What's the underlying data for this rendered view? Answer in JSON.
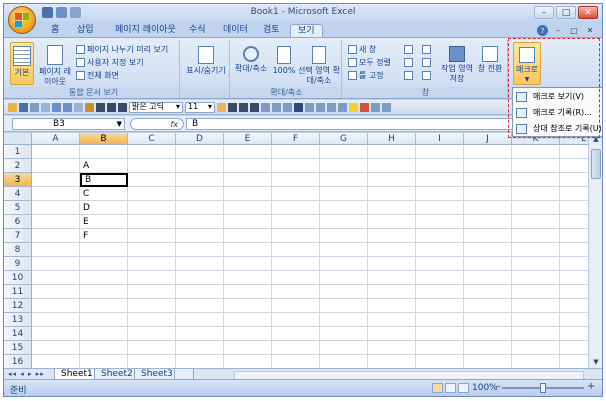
{
  "window": {
    "title": "Book1 - Microsoft Excel",
    "controls": {
      "minimize": "–",
      "maximize": "□",
      "close": "✕"
    }
  },
  "tabs": [
    "홈",
    "삽입",
    "페이지 레이아웃",
    "수식",
    "데이터",
    "검토",
    "보기"
  ],
  "active_tab": "보기",
  "tab_right": {
    "help": "?",
    "min": "–",
    "restore": "□",
    "close": "✕"
  },
  "ribbon": {
    "group_workbook_views": {
      "label": "통합 문서 보기",
      "normal": "기본",
      "page_layout": "페이지 레이아웃",
      "page_break": "페이지 나누기 미리 보기",
      "custom_views": "사용자 지정 보기",
      "full_screen": "전체 화면"
    },
    "group_show_hide": {
      "label": "표시/숨기기"
    },
    "group_zoom": {
      "label": "확대/축소",
      "zoom": "확대/축소",
      "zoom100": "100%",
      "zoom_selection": "선택 영역 확대/축소"
    },
    "group_window": {
      "label": "창",
      "new_window": "새 창",
      "arrange_all": "모두 정렬",
      "freeze": "틀 고정",
      "save_workspace": "작업 영역 저장",
      "switch_windows": "창 전환"
    },
    "group_macros": {
      "macro": "매크로"
    }
  },
  "macro_menu": {
    "view": "매크로 보기(V)",
    "record": "매크로 기록(R)...",
    "relative": "상대 참조로 기록(U)"
  },
  "format_toolbar": {
    "font": "맑은 고딕",
    "size": "11"
  },
  "formula_bar": {
    "name_box": "B3",
    "fx": "fx",
    "value": "B"
  },
  "columns": [
    "A",
    "B",
    "C",
    "D",
    "E",
    "F",
    "G",
    "H",
    "I",
    "J",
    "K",
    "L"
  ],
  "rows": [
    "1",
    "2",
    "3",
    "4",
    "5",
    "6",
    "7",
    "8",
    "9",
    "10",
    "11",
    "12",
    "13",
    "14",
    "15",
    "16"
  ],
  "selected_cell": {
    "col": "B",
    "row": "3"
  },
  "cells": [
    {
      "col": 1,
      "row": 1,
      "value": "A"
    },
    {
      "col": 1,
      "row": 2,
      "value": "B"
    },
    {
      "col": 1,
      "row": 3,
      "value": "C"
    },
    {
      "col": 1,
      "row": 4,
      "value": "D"
    },
    {
      "col": 1,
      "row": 5,
      "value": "E"
    },
    {
      "col": 1,
      "row": 6,
      "value": "F"
    }
  ],
  "sheets": [
    "Sheet1",
    "Sheet2",
    "Sheet3"
  ],
  "active_sheet": "Sheet1",
  "status": {
    "ready": "준비",
    "zoom": "100%",
    "zoom_out": "–",
    "zoom_in": "+"
  },
  "colors": {
    "accent": "#15428b",
    "highlight": "#f9d99f",
    "annotation": "#e0262b"
  }
}
